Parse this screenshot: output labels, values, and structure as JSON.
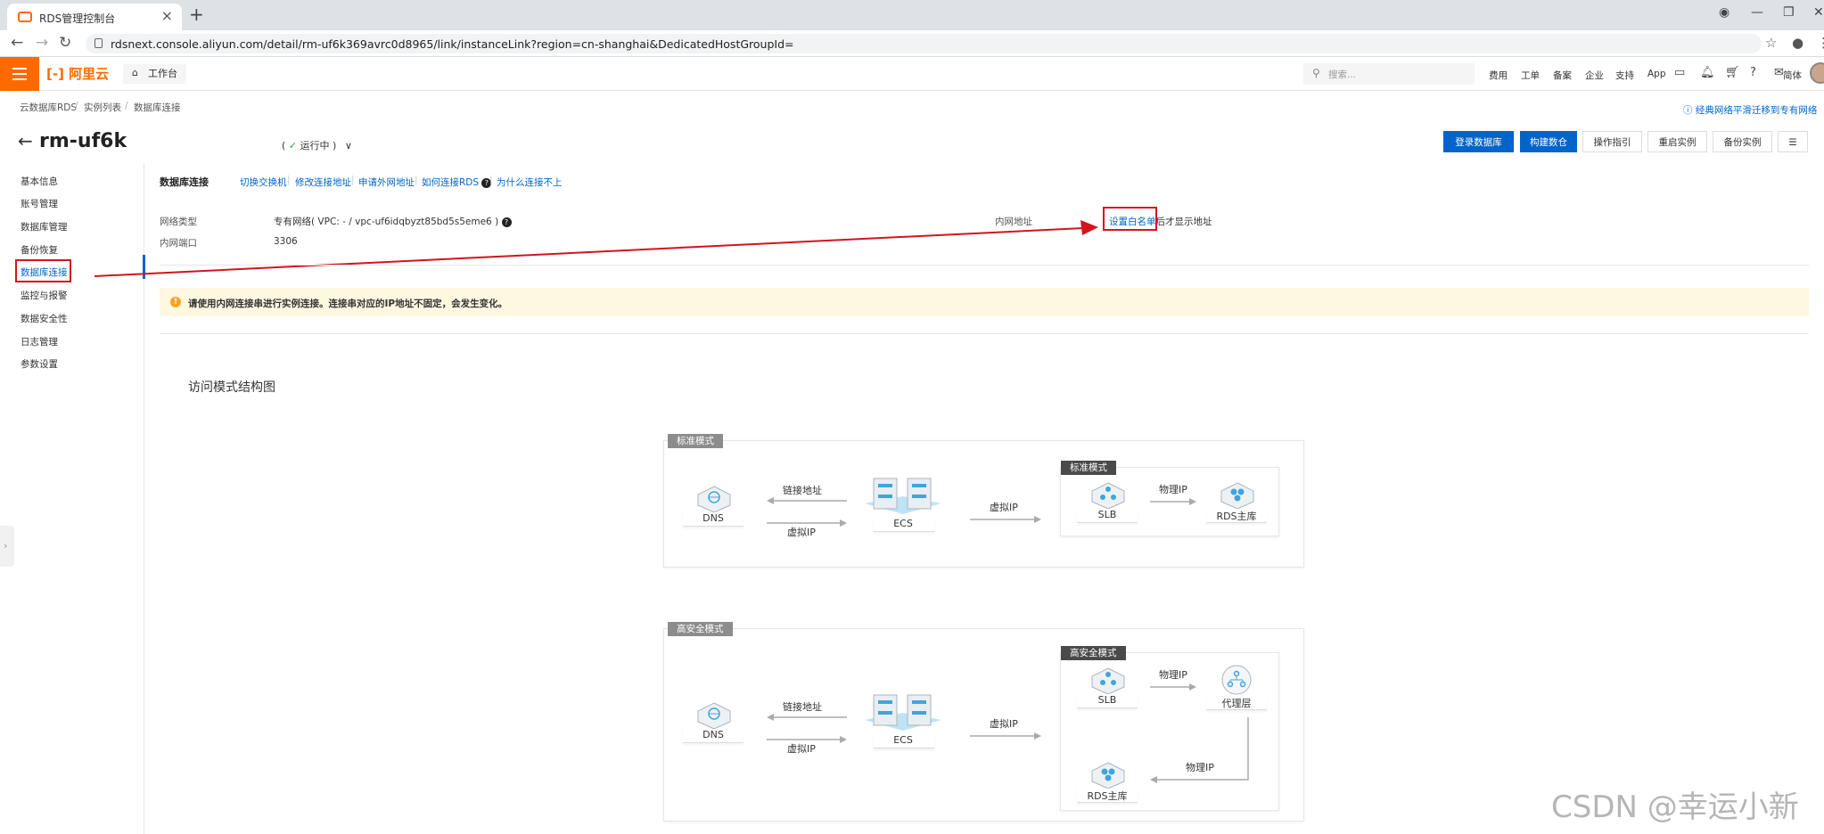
{
  "browser": {
    "tab_title": "RDS管理控制台",
    "url": "rdsnext.console.aliyun.com/detail/rm-uf6k369avrc0d8965/link/instanceLink?region=cn-shanghai&DedicatedHostGroupId="
  },
  "topbar": {
    "logo": "阿里云",
    "workbench": "工作台",
    "search_placeholder": "搜索...",
    "nav": [
      "费用",
      "工单",
      "备案",
      "企业",
      "支持",
      "App"
    ],
    "lang": "简体"
  },
  "breadcrumb": [
    "云数据库RDS",
    "实例列表",
    "数据库连接"
  ],
  "migrate_link": "经典网络平滑迁移到专有网络",
  "instance": {
    "title": "rm-uf6k",
    "status_open": "(",
    "status_icon": "✓",
    "status": "运行中",
    "status_close": ")"
  },
  "header_buttons": [
    "登录数据库",
    "构建数仓",
    "操作指引",
    "重启实例",
    "备份实例"
  ],
  "sidebar": {
    "items": [
      "基本信息",
      "账号管理",
      "数据库管理",
      "备份恢复",
      "数据库连接",
      "监控与报警",
      "数据安全性",
      "日志管理",
      "参数设置"
    ],
    "active_index": 4
  },
  "connection": {
    "title": "数据库连接",
    "links": [
      "切换交换机",
      "修改连接地址",
      "申请外网地址",
      "如何连接RDS",
      "为什么连接不上"
    ],
    "network_type_label": "网络类型",
    "network_type_value": "专有网络( VPC: - / vpc-uf6idqbyzt85bd5s5eme6 )",
    "port_label": "内网端口",
    "port_value": "3306",
    "intranet_label": "内网地址",
    "whitelist_link": "设置白名单",
    "whitelist_suffix": "后才显示地址"
  },
  "notice": "请使用内网连接串进行实例连接。连接串对应的IP地址不固定，会发生变化。",
  "section_title": "访问模式结构图",
  "diagram_standard": {
    "tag": "标准模式",
    "inner_tag": "标准模式",
    "dns": "DNS",
    "link_addr": "链接地址",
    "virtual_ip_left": "虚拟IP",
    "ecs": "ECS",
    "virtual_ip": "虚拟IP",
    "slb": "SLB",
    "physical_ip": "物理IP",
    "rds_master": "RDS主库"
  },
  "diagram_secure": {
    "tag": "高安全模式",
    "inner_tag": "高安全模式",
    "dns": "DNS",
    "link_addr": "链接地址",
    "virtual_ip_left": "虚拟IP",
    "ecs": "ECS",
    "virtual_ip": "虚拟IP",
    "slb": "SLB",
    "physical_ip_top": "物理IP",
    "proxy": "代理层",
    "rds_master": "RDS主库",
    "physical_ip_bottom": "物理IP"
  },
  "watermark": "CSDN @幸运小新",
  "colors": {
    "brand": "#ff6a00",
    "primary": "#0064c8",
    "annotation": "#d2141e",
    "notice_bg": "#fff8e1"
  }
}
